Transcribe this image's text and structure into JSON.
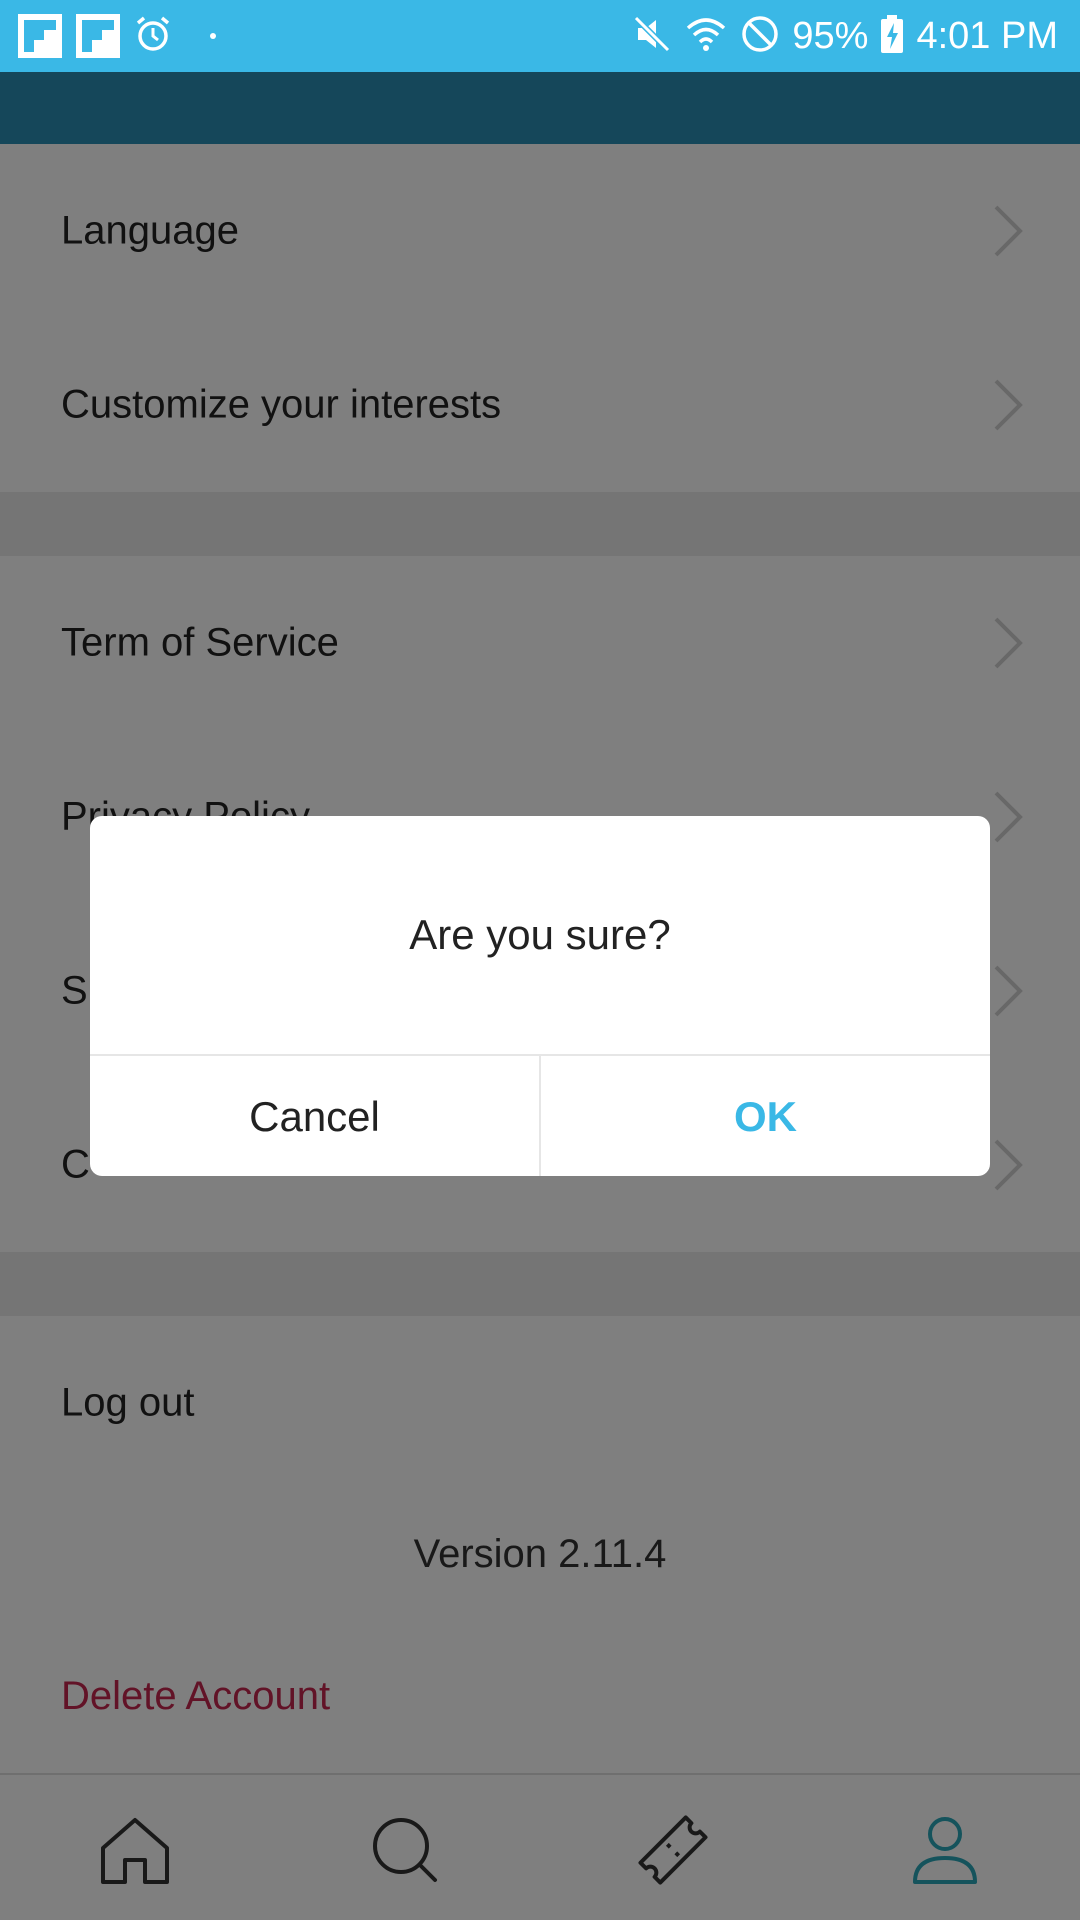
{
  "status_bar": {
    "battery": "95%",
    "time": "4:01 PM",
    "icons": [
      "flipboard-icon",
      "flipboard-icon",
      "alarm-icon",
      "mute-icon",
      "wifi-icon",
      "do-not-disturb-icon",
      "battery-charging-icon"
    ]
  },
  "settings": {
    "group1": [
      "Language",
      "Customize your interests"
    ],
    "group2": [
      "Term of Service",
      "Privacy Policy",
      "S",
      "C"
    ],
    "logout": "Log out",
    "version": "Version 2.11.4",
    "delete_account": "Delete Account"
  },
  "dialog": {
    "message": "Are you sure?",
    "cancel": "Cancel",
    "ok": "OK"
  },
  "bottom_nav": {
    "items": [
      "home",
      "search",
      "tickets",
      "profile"
    ],
    "active": "profile"
  },
  "colors": {
    "status_bar": "#3ab8e6",
    "accent": "#3ab8e6",
    "danger": "#c4264f",
    "active_nav": "#2aa7b8"
  }
}
